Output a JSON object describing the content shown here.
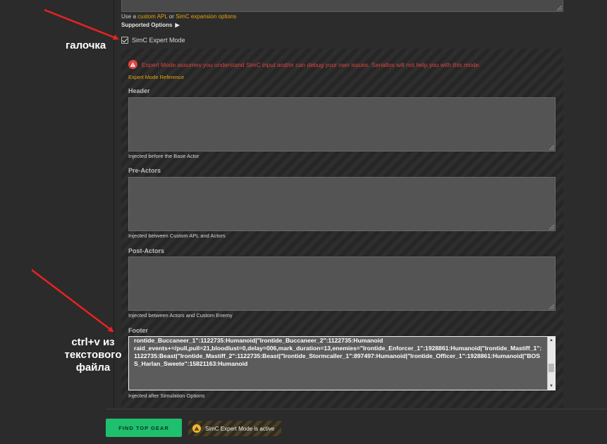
{
  "top": {
    "apl_prefix": "Use a ",
    "apl_link1": "custom APL",
    "apl_or": " or ",
    "apl_link2": "SimC expansion options",
    "supported_label": "Supported Options",
    "supported_icon": "caret-right-icon"
  },
  "expert_mode": {
    "checkbox_label": "SimC Expert Mode",
    "checked": true,
    "warning": "Expert Mode assumes you understand SimC input and/or can debug your own issues. Seriallos will not help you with this mode.",
    "warning_icon": "alert-icon",
    "reference_link": "Expert Mode Reference"
  },
  "fields": {
    "header": {
      "label": "Header",
      "help": "Injected before the Base Actor",
      "value": ""
    },
    "pre_actors": {
      "label": "Pre-Actors",
      "help": "Injected between Custom APL and Actors",
      "value": ""
    },
    "post_actors": {
      "label": "Post-Actors",
      "help": "Injected between Actors and Custom Enemy",
      "value": ""
    },
    "footer": {
      "label": "Footer",
      "help": "Injected after Simulation Options",
      "value": "rontide_Buccaneer_1\":1122735:Humanoid|\"Irontide_Buccaneer_2\":1122735:Humanoid\nraid_events+=/pull,pull=21,bloodlust=0,delay=006,mark_duration=13,enemies=\"Irontide_Enforcer_1\":1928861:Humanoid|\"Irontide_Mastiff_1\":1122735:Beast|\"Irontide_Mastiff_2\":1122735:Beast|\"Irontide_Stormcaller_1\":897497:Humanoid|\"Irontide_Officer_1\":1928861:Humanoid|\"BOSS_Harlan_Sweete\":15821163:Humanoid"
    }
  },
  "bottom": {
    "find_button": "FIND TOP GEAR",
    "active_badge": "SimC Expert Mode is active",
    "badge_icon": "warning-icon"
  },
  "annotations": {
    "checkbox_note": "галочка",
    "paste_note_line1": "ctrl+v из",
    "paste_note_line2": "текстового",
    "paste_note_line3": "файла",
    "arrow_color": "#e8231f"
  },
  "colors": {
    "accent_link": "#e5a50a",
    "warning_red": "#e0453e",
    "button_green": "#1ec06e"
  }
}
